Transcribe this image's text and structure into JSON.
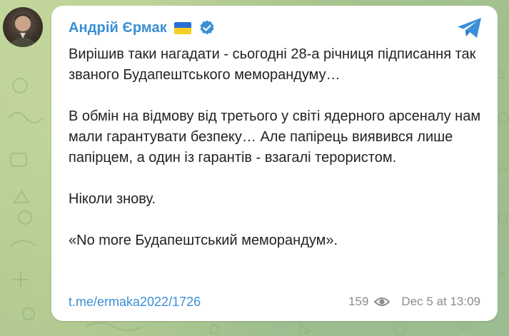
{
  "post": {
    "channel_name": "Андрій Єрмак",
    "flag_emoji": "ukraine-flag",
    "verified_icon": "verified-badge-icon",
    "paragraphs": [
      "Вирішив таки нагадати - сьогодні 28-а річниця підписання так званого Будапештського меморандуму…",
      "В обмін на відмову від третього у світі ядерного арсеналу нам мали гарантувати безпеку… Але папірець виявився лише папірцем, а один із гарантів - взагалі терористом.",
      "Ніколи знову.",
      "«No more Будапештський меморандум»."
    ],
    "link": "t.me/ermaka2022/1726",
    "views": "159",
    "timestamp": "Dec 5 at 13:09"
  },
  "colors": {
    "accent": "#3a8fd6",
    "text": "#222222",
    "meta": "#8c8c8c",
    "flag_blue": "#2a6fd6",
    "flag_yellow": "#f6cf23"
  },
  "icons": {
    "share": "telegram-share-icon",
    "views": "eye-icon"
  }
}
